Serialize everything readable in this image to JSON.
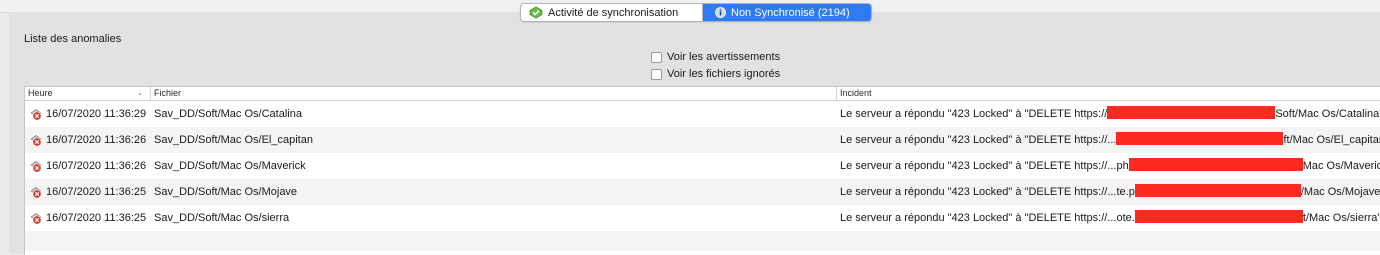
{
  "tabs": [
    {
      "label": "Activité de synchronisation",
      "icon": "sync-check-icon",
      "selected": false
    },
    {
      "label": "Non Synchronisé (2194)",
      "icon": "info-icon",
      "selected": true
    }
  ],
  "section_title": "Liste des anomalies",
  "filters": {
    "show_warnings": {
      "label": "Voir les avertissements",
      "checked": false
    },
    "show_ignored": {
      "label": "Voir les fichiers ignorés",
      "checked": false
    }
  },
  "table": {
    "columns": [
      "Heure",
      "Fichier",
      "Incident"
    ],
    "sorted_column": "Heure",
    "rows": [
      {
        "time": "16/07/2020 11:36:29",
        "file": "Sav_DD/Soft/Mac Os/Catalina",
        "incident_prefix": "Le serveur a répondu \"423 Locked\"  à \"DELETE https://",
        "incident_suffix": "Soft/Mac Os/Catalina\""
      },
      {
        "time": "16/07/2020 11:36:26",
        "file": "Sav_DD/Soft/Mac Os/El_capitan",
        "incident_prefix": "Le serveur a répondu \"423 Locked\"  à \"DELETE https://...",
        "incident_suffix": "ft/Mac Os/El_capitan\""
      },
      {
        "time": "16/07/2020 11:36:26",
        "file": "Sav_DD/Soft/Mac Os/Maverick",
        "incident_prefix": "Le serveur a répondu \"423 Locked\"  à \"DELETE https://...ph",
        "incident_suffix": "Mac Os/Maverick\""
      },
      {
        "time": "16/07/2020 11:36:25",
        "file": "Sav_DD/Soft/Mac Os/Mojave",
        "incident_prefix": "Le serveur a répondu \"423 Locked\"  à \"DELETE https://...te.p",
        "incident_suffix": "/Mac Os/Mojave\""
      },
      {
        "time": "16/07/2020 11:36:25",
        "file": "Sav_DD/Soft/Mac Os/sierra",
        "incident_prefix": "Le serveur a répondu \"423 Locked\"  à \"DELETE https://...ote.",
        "incident_suffix": "t/Mac Os/sierra\""
      }
    ]
  },
  "colors": {
    "selected_tab": "#2f7bf5",
    "redaction": "#ff2a1f",
    "error_badge": "#d63a32"
  }
}
